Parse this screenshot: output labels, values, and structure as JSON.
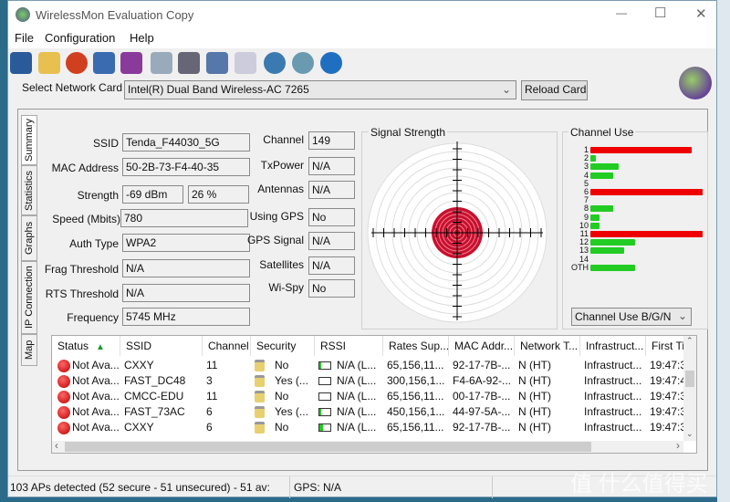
{
  "window": {
    "title": "WirelessMon Evaluation Copy",
    "minimize": "—",
    "maximize": "☐",
    "close": "✕"
  },
  "menu": [
    "File",
    "Configuration",
    "Help"
  ],
  "toolbar": [
    "save-icon",
    "open-folder-icon",
    "target-icon",
    "network-cards-icon",
    "network-disconnect-icon",
    "export-icon",
    "print-icon",
    "log-icon",
    "clipboard-icon",
    "globe-icon",
    "info-icon",
    "help-icon"
  ],
  "card": {
    "label": "Select Network Card",
    "value": "Intel(R) Dual Band Wireless-AC 7265",
    "reload": "Reload Cards"
  },
  "tabs": [
    "Summary",
    "Statistics",
    "Graphs",
    "IP Connection",
    "Map"
  ],
  "summary": {
    "left": [
      {
        "label": "SSID",
        "value": "Tenda_F44030_5G"
      },
      {
        "label": "MAC Address",
        "value": "50-2B-73-F4-40-35"
      },
      {
        "label": "Strength",
        "value": "-69 dBm",
        "value2": "26 %"
      },
      {
        "label": "Speed (Mbits)",
        "value": "780"
      },
      {
        "label": "Auth Type",
        "value": "WPA2"
      },
      {
        "label": "Frag Threshold",
        "value": "N/A"
      },
      {
        "label": "RTS Threshold",
        "value": "N/A"
      },
      {
        "label": "Frequency",
        "value": "5745 MHz"
      }
    ],
    "right": [
      {
        "label": "Channel",
        "value": "149"
      },
      {
        "label": "TxPower",
        "value": "N/A"
      },
      {
        "label": "Antennas",
        "value": "N/A"
      },
      {
        "label": "Using GPS",
        "value": "No"
      },
      {
        "label": "GPS Signal",
        "value": "N/A"
      },
      {
        "label": "Satellites",
        "value": "N/A"
      },
      {
        "label": "Wi-Spy",
        "value": "No"
      }
    ]
  },
  "signal": {
    "title": "Signal Strength",
    "percent": 26
  },
  "channel_use": {
    "title": "Channel Use",
    "dropdown": "Channel Use B/G/N",
    "channels": [
      {
        "ch": "1",
        "v": 9,
        "hot": true
      },
      {
        "ch": "2",
        "v": 0.5
      },
      {
        "ch": "3",
        "v": 2.5
      },
      {
        "ch": "4",
        "v": 2
      },
      {
        "ch": "5",
        "v": 0
      },
      {
        "ch": "6",
        "v": 10,
        "hot": true
      },
      {
        "ch": "7",
        "v": 0
      },
      {
        "ch": "8",
        "v": 2
      },
      {
        "ch": "9",
        "v": 0.8
      },
      {
        "ch": "10",
        "v": 0.8
      },
      {
        "ch": "11",
        "v": 10,
        "hot": true
      },
      {
        "ch": "12",
        "v": 4
      },
      {
        "ch": "13",
        "v": 3
      },
      {
        "ch": "14",
        "v": 0
      },
      {
        "ch": "OTH",
        "v": 4
      }
    ]
  },
  "table": {
    "columns": [
      "Status",
      "SSID",
      "Channel",
      "Security",
      "RSSI",
      "Rates Sup...",
      "MAC Addr...",
      "Network T...",
      "Infrastruct...",
      "First Tir"
    ],
    "rows": [
      [
        "Not Ava...",
        "CXXY",
        "11",
        "No",
        "N/A (L...",
        "65,156,11...",
        "92-17-7B-...",
        "N (HT)",
        "Infrastruct...",
        "19:47:3"
      ],
      [
        "Not Ava...",
        "FAST_DC48",
        "3",
        "Yes (...",
        "N/A (L...",
        "300,156,1...",
        "F4-6A-92-...",
        "N (HT)",
        "Infrastruct...",
        "19:47:4"
      ],
      [
        "Not Ava...",
        "CMCC-EDU",
        "11",
        "No",
        "N/A (L...",
        "65,156,11...",
        "00-17-7B-...",
        "N (HT)",
        "Infrastruct...",
        "19:47:3"
      ],
      [
        "Not Ava...",
        "FAST_73AC",
        "6",
        "Yes (...",
        "N/A (L...",
        "450,156,1...",
        "44-97-5A-...",
        "N (HT)",
        "Infrastruct...",
        "19:47:3"
      ],
      [
        "Not Ava...",
        "CXXY",
        "6",
        "No",
        "N/A (L...",
        "65,156,11...",
        "92-17-7B-...",
        "N (HT)",
        "Infrastruct...",
        "19:47:3"
      ]
    ]
  },
  "status": {
    "aps": "103 APs detected (52 secure - 51 unsecured) - 51 av:",
    "gps": "GPS: N/A"
  },
  "watermark": "值 什么值得买"
}
